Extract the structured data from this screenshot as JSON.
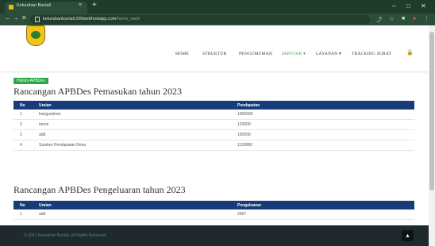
{
  "browser": {
    "tab_title": "Kelurahan Buniali",
    "tab_close": "×",
    "new_tab": "+",
    "url_host": "kelurahanbuniali.000webhostapp.com",
    "url_path": "/home_web/",
    "controls": {
      "minimize": "–",
      "maximize": "□",
      "close": "✕"
    },
    "nav": {
      "back": "←",
      "forward": "→",
      "reload": "✕"
    }
  },
  "menu": {
    "items": [
      "HOME",
      "STRUKTUR",
      "PENGUMUMAN",
      "SEPUTAR",
      "LAYANAN",
      "TRACKING SURAT"
    ],
    "active_index": 3
  },
  "page": {
    "badge": "History APBDes",
    "pemasukan": {
      "title": "Rancangan APBDes Pemasukan tahun 2023",
      "headers": [
        "No",
        "Uraian",
        "Pendapatan"
      ],
      "rows": [
        [
          "1",
          "bangunjman",
          "1000000"
        ],
        [
          "2",
          "tanos",
          "120000"
        ],
        [
          "3",
          "add",
          "100000"
        ],
        [
          "4",
          "Sumber Pendapatan Desa",
          "1120000"
        ]
      ]
    },
    "pengeluaran": {
      "title": "Rancangan APBDes Pengeluaran tahun 2023",
      "headers": [
        "No",
        "Uraian",
        "Pengeluaran"
      ],
      "rows": [
        [
          "1",
          "add",
          "2567"
        ]
      ]
    }
  },
  "footer": {
    "copyright": "© 2023 Kelurahan Buniali. All Rights Reserved.",
    "to_top": "▴"
  },
  "colors": {
    "accent_green": "#28a745",
    "table_header": "#163c7a",
    "browser_frame": "#1f3c2a"
  }
}
